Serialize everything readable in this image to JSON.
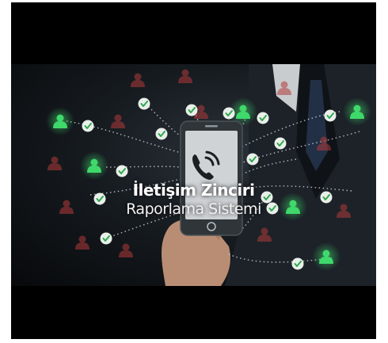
{
  "video": {
    "title": "İletişim Zinciri",
    "subtitle": "Raporlama Sistemi"
  },
  "colors": {
    "frame": "#000000",
    "node_green": "#3fd96b",
    "node_red": "#b23a3a",
    "check_badge": "#e9efe9",
    "check_mark": "#2fa84f",
    "phone_screen": "#cfd3d6"
  },
  "icons": [
    "phone-call-icon",
    "person-icon",
    "checkmark-icon"
  ]
}
